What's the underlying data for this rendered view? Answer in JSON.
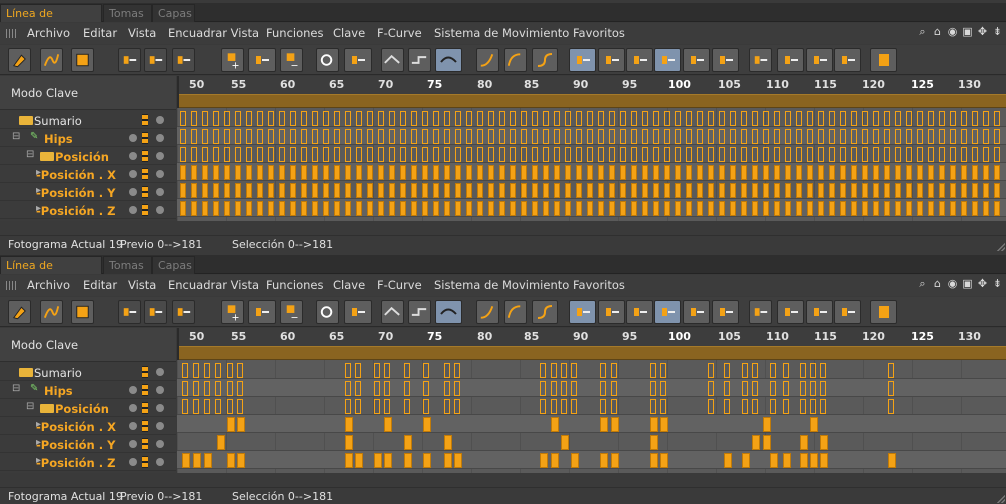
{
  "tabs": [
    {
      "label": "Línea de Tiempo",
      "active": true
    },
    {
      "label": "Tomas",
      "active": false
    },
    {
      "label": "Capas",
      "active": false
    }
  ],
  "menu": [
    "Archivo",
    "Editar",
    "Vista",
    "Encuadrar Vista",
    "Funciones",
    "Clave",
    "F-Curve",
    "Sistema de Movimiento",
    "Favoritos"
  ],
  "window_icons": [
    "magnifier-icon",
    "home-icon",
    "eye-icon",
    "new-window-icon",
    "move-icon",
    "pin-icon"
  ],
  "toolbar_buttons": [
    "key-mode-icon",
    "fcurve-mode-icon",
    "motion-mode-icon",
    "snap-keys-icon",
    "snap-curve-icon",
    "marker-icon",
    "add-key-icon",
    "add-all-keys-icon",
    "delete-key-icon",
    "zero-angle-icon",
    "zero-length-icon",
    "linear-icon",
    "step-icon",
    "spline-icon",
    "ease-in-icon",
    "ease-out-icon",
    "ease-ease-icon",
    "auto-tangent-icon",
    "clamp-icon",
    "weight-icon",
    "weighted-tangent-icon",
    "break-tangent-icon",
    "lock-value-icon",
    "lock-time-icon",
    "lock-tangent-icon",
    "lock-length-icon",
    "remove-overshoot-icon"
  ],
  "mode_label": "Modo Clave",
  "tracks": [
    {
      "label": "Sumario",
      "style": "white",
      "icon": "folder-icon"
    },
    {
      "label": "Hips",
      "style": "orange",
      "icon": "bone-icon"
    },
    {
      "label": "Posición",
      "style": "orange",
      "icon": "folder-open-icon"
    },
    {
      "label": "-Posición . X",
      "style": "orange",
      "icon": ""
    },
    {
      "label": "-Posición . Y",
      "style": "orange",
      "icon": ""
    },
    {
      "label": "-Posición . Z",
      "style": "orange",
      "icon": ""
    }
  ],
  "ruler_ticks": [
    "50",
    "55",
    "60",
    "65",
    "70",
    "75",
    "80",
    "85",
    "90",
    "95",
    "100",
    "105",
    "110",
    "115",
    "120",
    "125",
    "130"
  ],
  "status": {
    "frame": "Fotograma Actual 19",
    "preview": "Previo  0-->181",
    "selection": "Selección 0-->181"
  },
  "colors": {
    "accent": "#f4a215",
    "key_band": "#8a6420",
    "active_btn": "#7f93ad"
  }
}
